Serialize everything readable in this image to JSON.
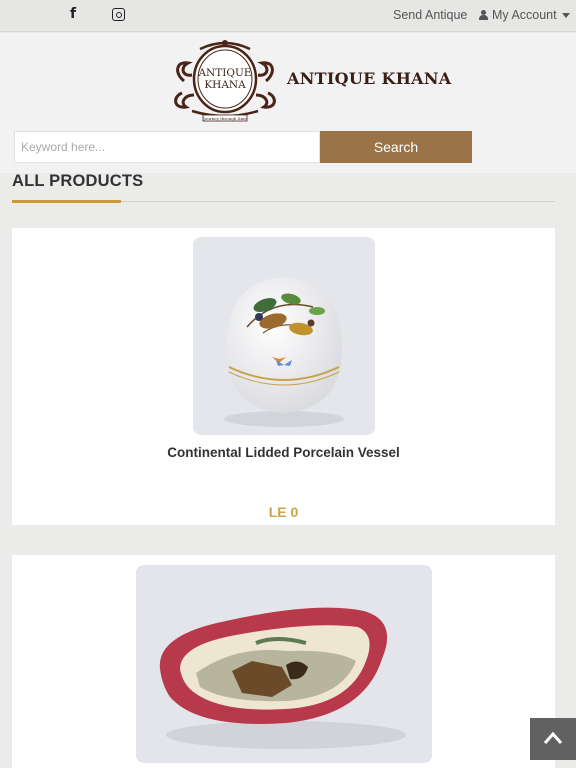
{
  "topbar": {
    "facebook_icon": "facebook-icon",
    "instagram_icon": "instagram-icon",
    "facebook_glyph": "f",
    "send_antique": "Send Antique",
    "my_account": "My Account"
  },
  "header": {
    "brand_name": "ANTIQUE KHANA",
    "logo_text_line1": "ANTIQUE",
    "logo_text_line2": "KHANA",
    "logo_tagline": "Journey through time",
    "search_placeholder": "Keyword here...",
    "search_button": "Search"
  },
  "section": {
    "title": "ALL PRODUCTS"
  },
  "products": [
    {
      "name": "Continental Lidded Porcelain Vessel",
      "price": "LE 0"
    },
    {
      "name": "",
      "price": ""
    }
  ],
  "colors": {
    "accent_gold": "#c9a24a",
    "search_button_bg": "#9a7448",
    "brand_dark": "#3a1f16"
  },
  "back_to_top_icon": "chevron-up-icon"
}
